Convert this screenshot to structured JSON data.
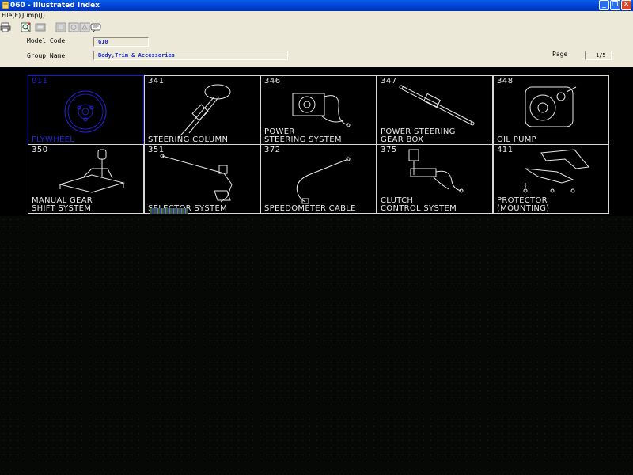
{
  "window": {
    "title": "060 - Illustrated Index"
  },
  "menu": {
    "items": [
      "File(F)",
      "Jump(J)"
    ]
  },
  "toolbar": {
    "buttons": [
      "print-icon",
      "zoom-icon",
      "image-icon",
      "copy-icon",
      "paste-icon",
      "settings-icon",
      "chat-icon"
    ]
  },
  "form": {
    "model_code_label": "Model Code",
    "model_code_value": "G10",
    "group_name_label": "Group Name",
    "group_name_value": "Body,Trim & Accessories",
    "page_label": "Page",
    "page_value": "1/5"
  },
  "grid": {
    "cells": [
      {
        "code": "011",
        "name_lines": [
          "FLYWHEEL"
        ],
        "selected": true
      },
      {
        "code": "341",
        "name_lines": [
          "STEERING COLUMN"
        ]
      },
      {
        "code": "346",
        "name_lines": [
          "POWER",
          "STEERING SYSTEM"
        ]
      },
      {
        "code": "347",
        "name_lines": [
          "POWER STEERING",
          "GEAR BOX"
        ]
      },
      {
        "code": "348",
        "name_lines": [
          "OIL PUMP"
        ]
      },
      {
        "code": "350",
        "name_lines": [
          "MANUAL GEAR",
          "SHIFT SYSTEM"
        ]
      },
      {
        "code": "351",
        "name_lines": [
          "SELECTOR SYSTEM"
        ]
      },
      {
        "code": "372",
        "name_lines": [
          "SPEEDOMETER CABLE"
        ]
      },
      {
        "code": "375",
        "name_lines": [
          "CLUTCH",
          "CONTROL SYSTEM"
        ]
      },
      {
        "code": "411",
        "name_lines": [
          "PROTECTOR",
          "(MOUNTING)"
        ]
      }
    ]
  },
  "colors": {
    "selected": "#2424e0",
    "line": "#e8e8e8",
    "titlebar": "#0a5ee8"
  }
}
